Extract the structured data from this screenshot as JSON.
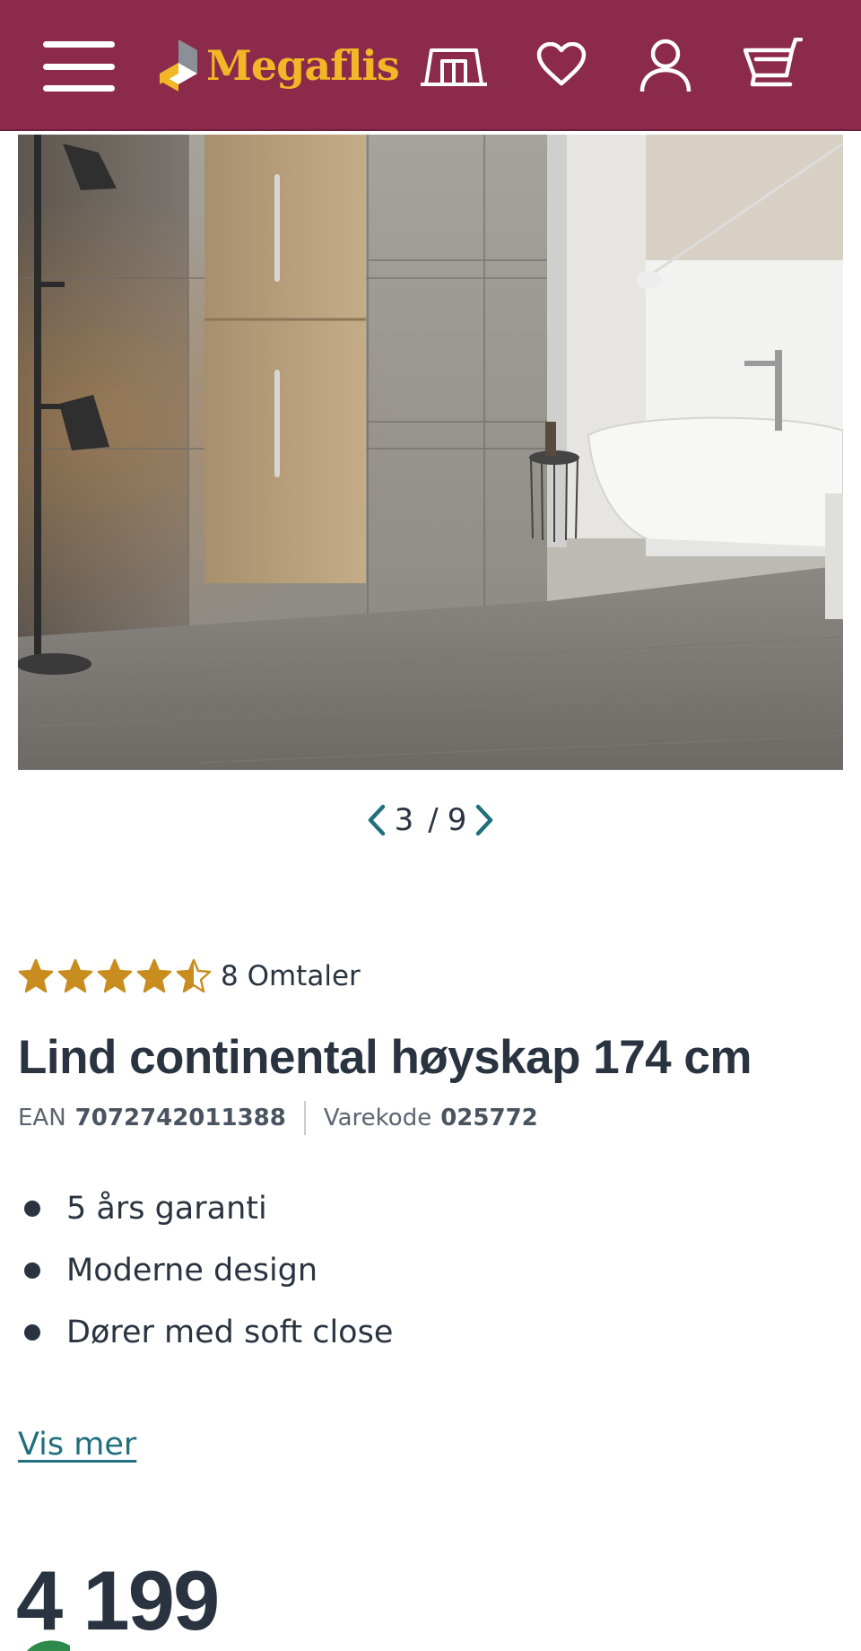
{
  "header": {
    "brand_name": "Megaflis",
    "background_color": "#8c2a4c",
    "brand_color": "#f2b626",
    "icons": [
      "menu-icon",
      "showroom-icon",
      "heart-icon",
      "user-icon",
      "cart-icon"
    ]
  },
  "gallery": {
    "current": "3",
    "total": "9",
    "separator": "/"
  },
  "rating": {
    "score": 4.5,
    "max": 5,
    "count_label": "8 Omtaler",
    "star_color": "#c98d1f"
  },
  "product": {
    "title": "Lind continental høyskap 174 cm",
    "ean_label": "EAN",
    "ean_value": "7072742011388",
    "code_label": "Varekode",
    "code_value": "025772",
    "features": [
      "5 års garanti",
      "Moderne design",
      "Dører med soft close"
    ],
    "more_link": "Vis mer",
    "link_color": "#1f6f7c",
    "price": "4 199"
  }
}
